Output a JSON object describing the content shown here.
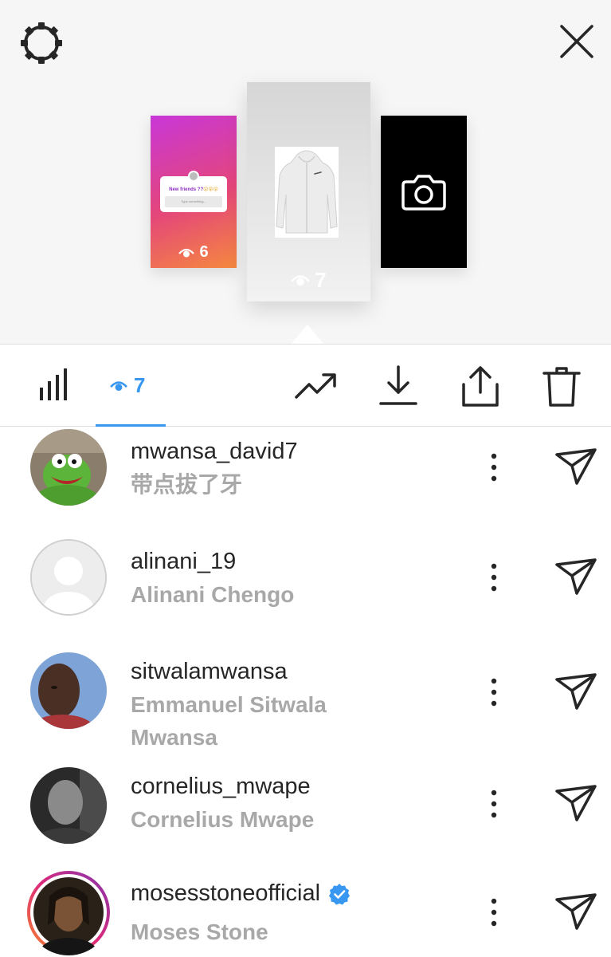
{
  "stories": [
    {
      "type": "question-sticker",
      "views": "6",
      "sticker": {
        "title": "New friends ??",
        "title_emoji": "😲😲😲",
        "placeholder": "Type something..."
      }
    },
    {
      "type": "product-photo",
      "views": "7"
    },
    {
      "type": "camera",
      "icon": "camera-icon"
    }
  ],
  "tabs": {
    "insights_icon": "bar-chart-icon",
    "viewers_icon": "eye-icon",
    "viewers_count": "7"
  },
  "actions": [
    {
      "name": "promote",
      "icon": "trending-up-icon"
    },
    {
      "name": "download",
      "icon": "download-icon"
    },
    {
      "name": "share",
      "icon": "share-icon"
    },
    {
      "name": "delete",
      "icon": "trash-icon"
    }
  ],
  "viewers": [
    {
      "username": "mwansa_david7",
      "full_name": "带点拔了牙",
      "avatar": "kermit"
    },
    {
      "username": "alinani_19",
      "full_name": "Alinani Chengo",
      "avatar": "default"
    },
    {
      "username": "sitwalamwansa",
      "full_name": "Emmanuel Sitwala Mwansa",
      "avatar": "photo"
    },
    {
      "username": "cornelius_mwape",
      "full_name": "Cornelius Mwape",
      "avatar": "photo-bw"
    },
    {
      "username": "mosesstoneofficial",
      "full_name": "Moses Stone",
      "avatar": "photo-story-ring",
      "verified": true
    }
  ],
  "colors": {
    "accent": "#3897f0",
    "text_primary": "#262626",
    "text_secondary": "#a8a8a8",
    "verified": "#3897f0"
  }
}
